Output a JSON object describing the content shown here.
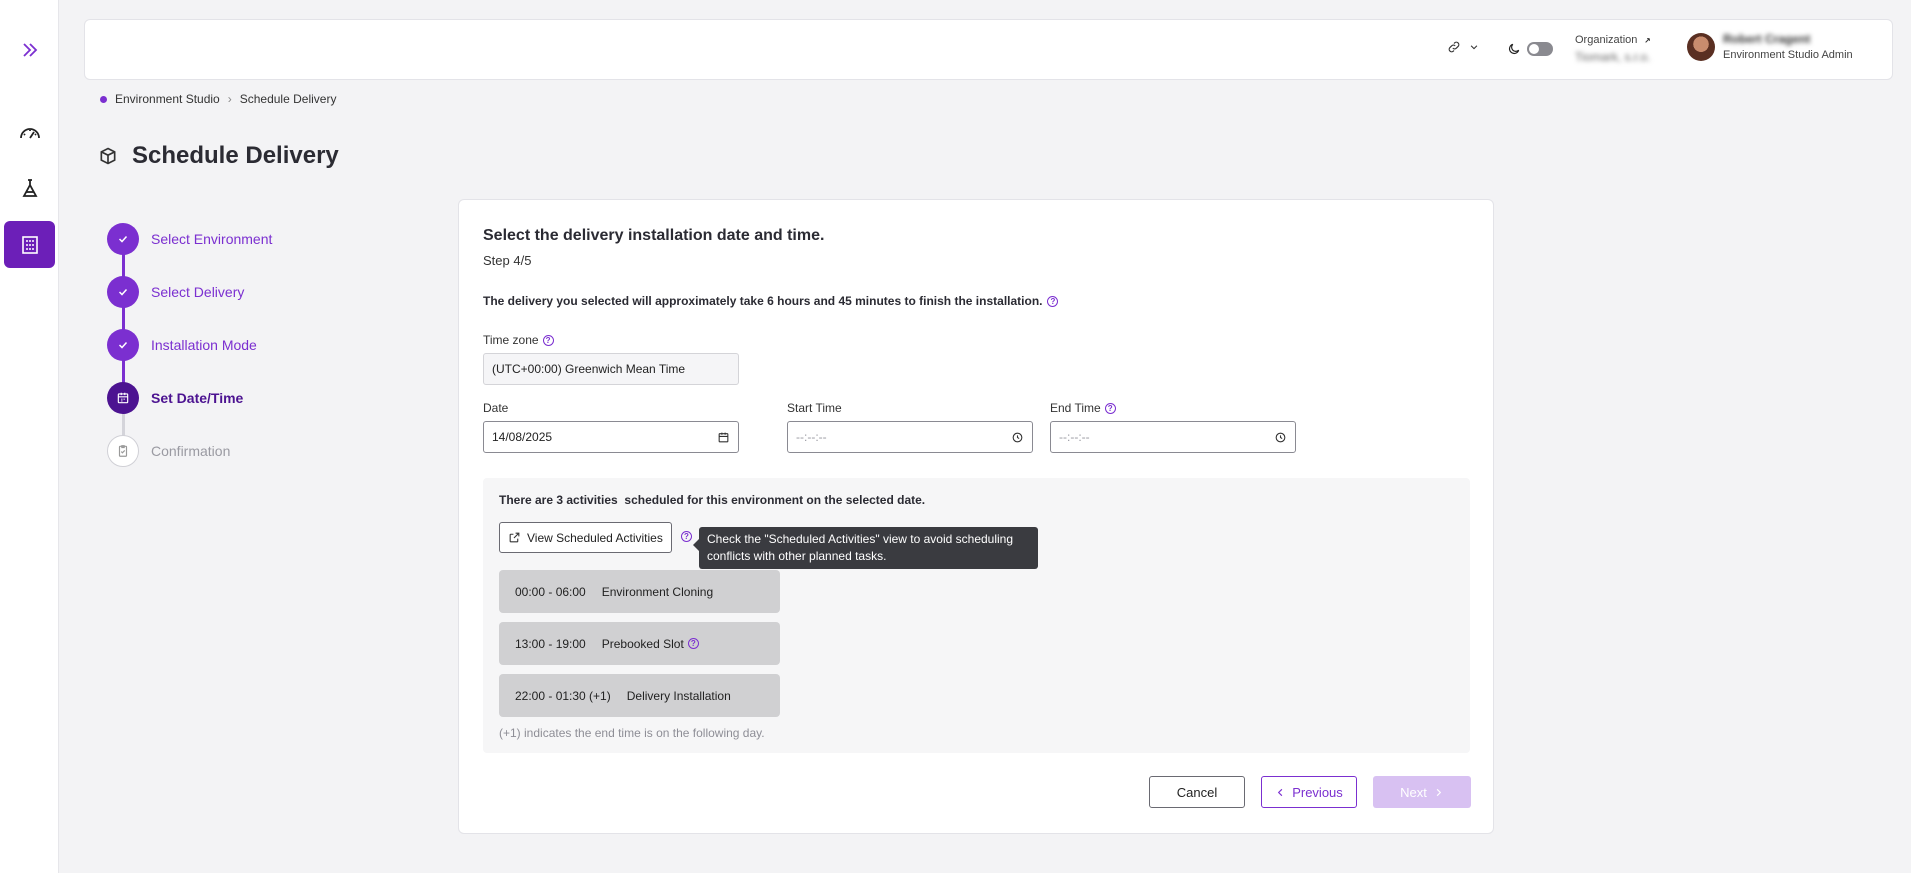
{
  "rail": {
    "items": [
      {
        "icon": "double-chevron-right-icon"
      },
      {
        "icon": "speedometer-icon"
      },
      {
        "icon": "flask-icon"
      },
      {
        "icon": "building-icon",
        "active": true
      }
    ]
  },
  "header": {
    "org_label": "Organization",
    "org_value": "Tiomark, s.r.o.",
    "user_name": "Robert Cragent",
    "user_role": "Environment Studio Admin"
  },
  "breadcrumb": {
    "root": "Environment Studio",
    "current": "Schedule Delivery"
  },
  "page": {
    "title": "Schedule Delivery"
  },
  "stepper": {
    "steps": [
      {
        "label": "Select Environment",
        "state": "done"
      },
      {
        "label": "Select Delivery",
        "state": "done"
      },
      {
        "label": "Installation Mode",
        "state": "done"
      },
      {
        "label": "Set Date/Time",
        "state": "current"
      },
      {
        "label": "Confirmation",
        "state": "pending"
      }
    ]
  },
  "form": {
    "title": "Select the delivery installation  date and time.",
    "step": "Step 4/5",
    "note": "The delivery you selected will approximately take 6 hours and 45 minutes to finish the installation.",
    "timezone_label": "Time zone",
    "timezone_value": "(UTC+00:00) Greenwich Mean Time",
    "date_label": "Date",
    "date_value": "14/08/2025",
    "start_label": "Start Time",
    "start_placeholder": "--:--:--",
    "end_label": "End Time",
    "end_placeholder": "--:--:--"
  },
  "activities": {
    "title": "There are 3 activities  scheduled for this environment on the selected date.",
    "view_button": "View Scheduled Activities",
    "tooltip": "Check the \"Scheduled Activities\" view to avoid scheduling conflicts with other planned tasks.",
    "items": [
      {
        "time": "00:00 - 06:00",
        "name": "Environment Cloning"
      },
      {
        "time": "13:00 - 19:00",
        "name": "Prebooked Slot"
      },
      {
        "time": "22:00 - 01:30 (+1)",
        "name": "Delivery Installation"
      }
    ],
    "footnote": "(+1) indicates the end time is on the following day."
  },
  "actions": {
    "cancel": "Cancel",
    "previous": "Previous",
    "next": "Next"
  },
  "colors": {
    "accent": "#7b2fd0",
    "accent_dark": "#4c1391",
    "rail_active": "#6c1fb8",
    "next_disabled": "#d8c1f2"
  }
}
